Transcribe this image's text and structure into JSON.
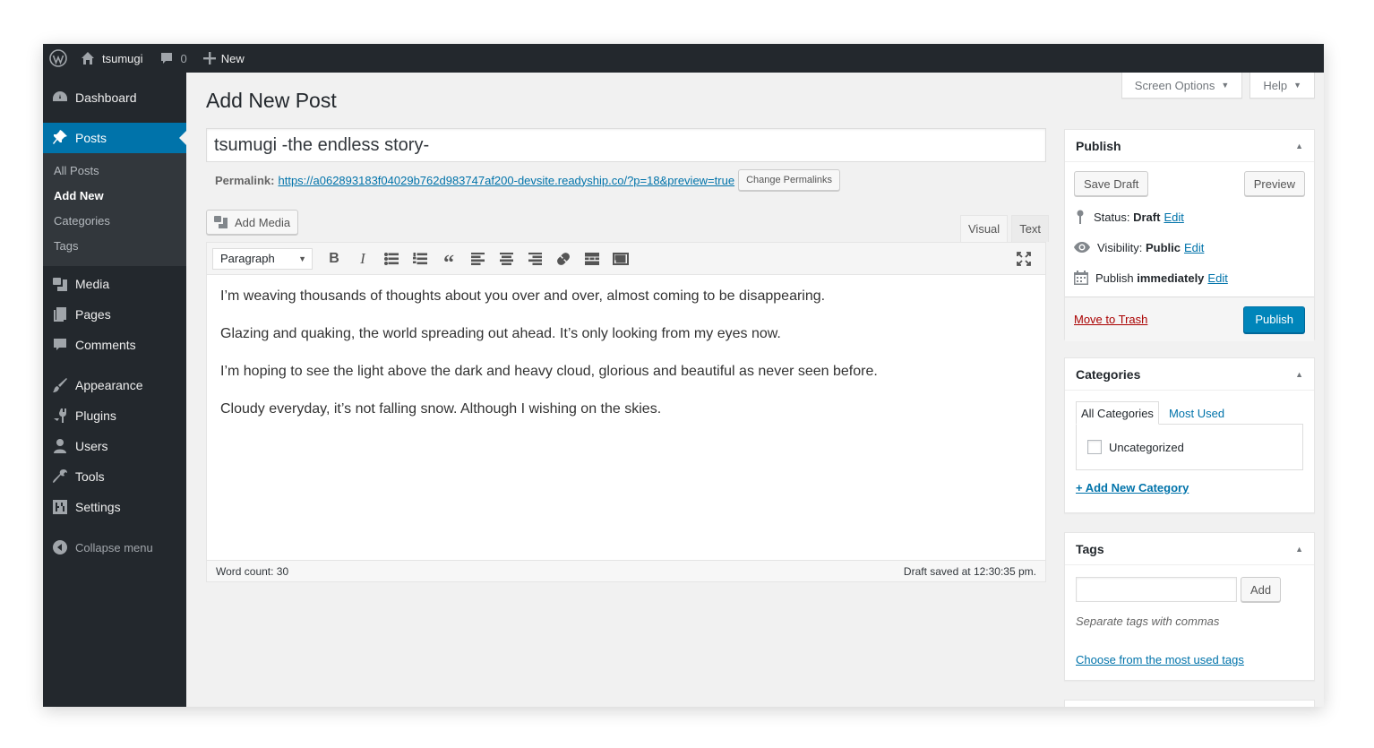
{
  "admin_bar": {
    "site_name": "tsumugi",
    "comment_count": "0",
    "new_label": "New"
  },
  "sidebar": {
    "items": [
      {
        "label": "Dashboard",
        "icon": "dashboard-icon"
      },
      {
        "label": "Posts",
        "icon": "pin-icon"
      },
      {
        "label": "Media",
        "icon": "media-icon"
      },
      {
        "label": "Pages",
        "icon": "pages-icon"
      },
      {
        "label": "Comments",
        "icon": "comments-icon"
      },
      {
        "label": "Appearance",
        "icon": "appearance-icon"
      },
      {
        "label": "Plugins",
        "icon": "plugins-icon"
      },
      {
        "label": "Users",
        "icon": "users-icon"
      },
      {
        "label": "Tools",
        "icon": "tools-icon"
      },
      {
        "label": "Settings",
        "icon": "settings-icon"
      }
    ],
    "posts_submenu": [
      "All Posts",
      "Add New",
      "Categories",
      "Tags"
    ],
    "collapse_label": "Collapse menu"
  },
  "header": {
    "screen_options": "Screen Options",
    "help": "Help",
    "title": "Add New Post"
  },
  "post": {
    "title": "tsumugi -the endless story-",
    "permalink_label": "Permalink:",
    "permalink_url": "https://a062893183f04029b762d983747af200-devsite.readyship.co/?p=18&preview=true",
    "change_permalinks": "Change Permalinks"
  },
  "editor": {
    "add_media": "Add Media",
    "tab_visual": "Visual",
    "tab_text": "Text",
    "format": "Paragraph",
    "paragraphs": [
      "I’m weaving thousands of thoughts about you over and over, almost coming to be disappearing.",
      "Glazing and quaking, the world spreading out ahead. It’s only looking from my eyes now.",
      "I’m hoping to see the light above the dark and heavy cloud, glorious and beautiful as never seen before.",
      "Cloudy everyday, it’s not falling snow. Although I wishing on the skies."
    ],
    "word_count": "Word count: 30",
    "draft_saved": "Draft saved at 12:30:35 pm."
  },
  "publish": {
    "title": "Publish",
    "save_draft": "Save Draft",
    "preview": "Preview",
    "status_label": "Status:",
    "status_value": "Draft",
    "visibility_label": "Visibility:",
    "visibility_value": "Public",
    "publish_label": "Publish",
    "publish_value": "immediately",
    "edit": "Edit",
    "move_to_trash": "Move to Trash",
    "publish_button": "Publish"
  },
  "categories": {
    "title": "Categories",
    "tab_all": "All Categories",
    "tab_most_used": "Most Used",
    "items": [
      "Uncategorized"
    ],
    "add_new": "+ Add New Category"
  },
  "tags": {
    "title": "Tags",
    "add_button": "Add",
    "hint": "Separate tags with commas",
    "choose_link": "Choose from the most used tags"
  },
  "colors": {
    "admin_bar": "#23282d",
    "sidebar": "#23282d",
    "accent": "#0073aa",
    "primary_button": "#0085ba",
    "trash": "#aa0000"
  }
}
